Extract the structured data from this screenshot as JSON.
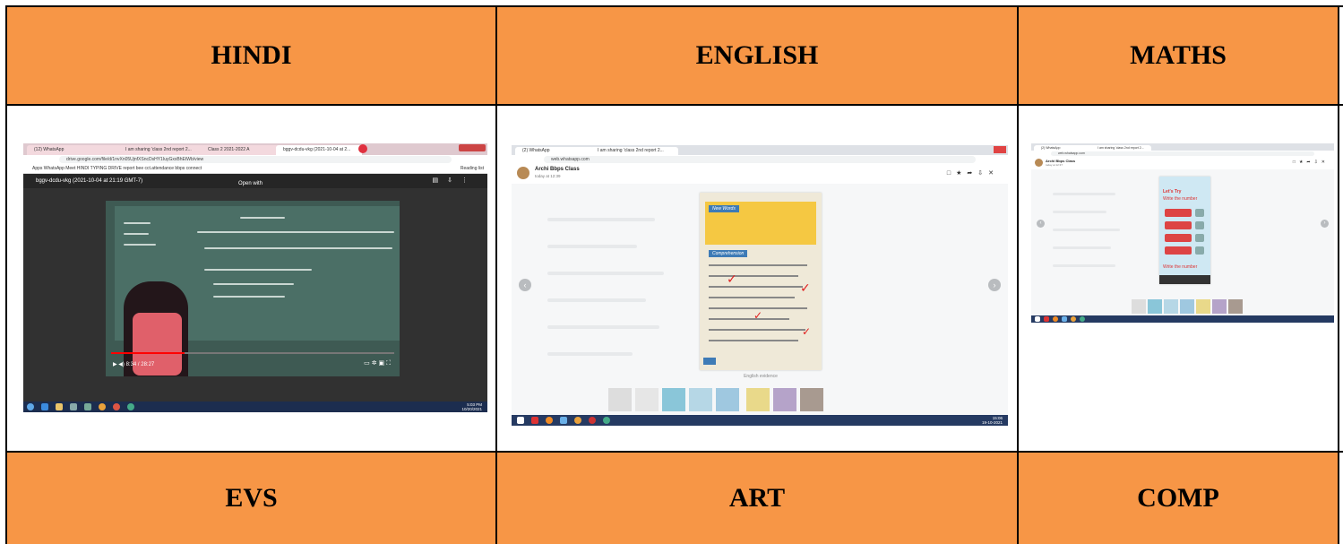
{
  "table": {
    "header_row": [
      "HINDI",
      "ENGLISH",
      "MATHS"
    ],
    "footer_row": [
      "EVS",
      "ART",
      "COMP"
    ],
    "header_color": "#f79646"
  },
  "hindi_shot": {
    "tabs": [
      "(12) WhatsApp",
      "I am sharing 'class 2nd report 2...",
      "Class 2 2021-2022 A",
      "bggv-dcdu-vkg (2021-10-04 at 2..."
    ],
    "address": "drive.google.com/file/d/1nvXn05UjnfXSncDsHY1IuyGxxBhEtWb/view",
    "bookmarks": "Apps   WhatsApp   Meet   HINDI TYPING   DRIVE   report bee   cct.attendance   bbps connect",
    "reading_list": "Reading list",
    "file_title": "bggv-dcdu-vkg (2021-10-04 at 21:19 GMT-7)",
    "open_with": "Open with",
    "time": "8:34 / 28:27",
    "clock_time": "5:03 PM",
    "clock_date": "10/20/2021"
  },
  "english_shot": {
    "tabs": [
      "(2) WhatsApp",
      "I am sharing 'class 2nd report 2..."
    ],
    "address": "web.whatsapp.com",
    "contact": "Archi Bbps Class",
    "contact_sub": "today at 12:39",
    "caption": "English evidence",
    "book_heading": "New Words",
    "book_heading2": "Comprehension",
    "clock_time": "15:06",
    "clock_date": "19-10-2021"
  },
  "maths_shot": {
    "tabs": [
      "(2) WhatsApp",
      "I am sharing 'class 2nd report 2..."
    ],
    "address": "web.whatsapp.com",
    "contact": "Archi Bbps Class",
    "contact_sub": "today at 12:37",
    "book_title": "Let's Try",
    "book_line": "Write the number",
    "book_line2": "Write the number"
  }
}
